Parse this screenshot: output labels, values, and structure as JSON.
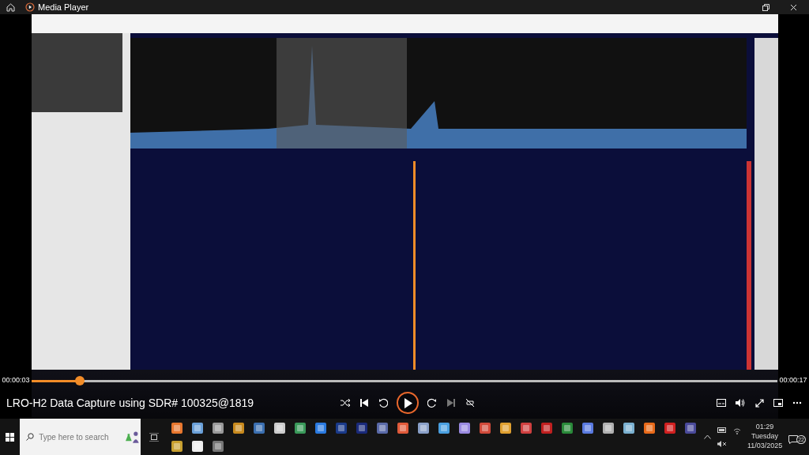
{
  "window": {
    "title": "Media Player"
  },
  "player": {
    "elapsed": "00:00:03",
    "duration": "00:00:17",
    "progress": {
      "level": 0.065
    },
    "media_title": "LRO-H2 Data Capture using SDR# 100325@1819",
    "playing": false
  },
  "taskbar": {
    "search": {
      "placeholder": "Type here to search"
    },
    "clock": {
      "time": "01:29",
      "day": "Tuesday",
      "date": "11/03/2025"
    },
    "notifications": {
      "count": "22"
    }
  }
}
